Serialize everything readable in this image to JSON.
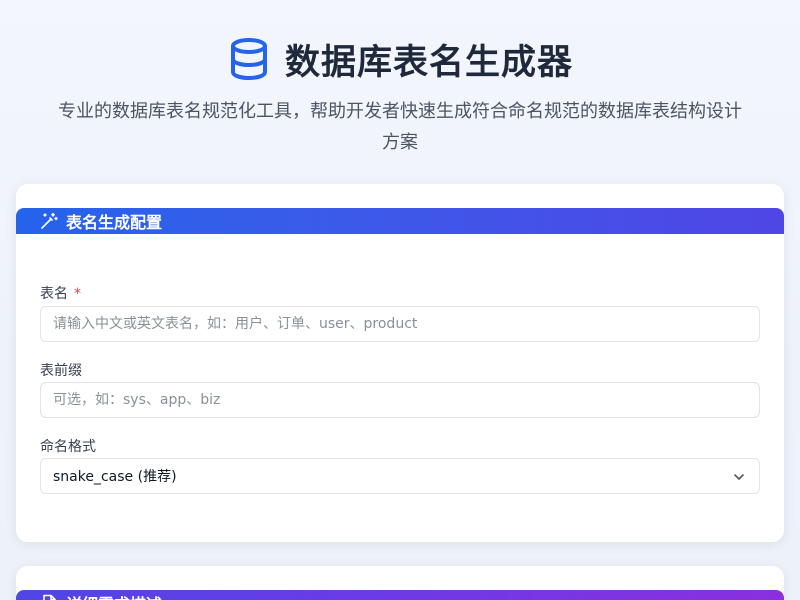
{
  "header": {
    "title": "数据库表名生成器",
    "subtitle": "专业的数据库表名规范化工具，帮助开发者快速生成符合命名规范的数据库表结构设计方案",
    "icon": "database-icon"
  },
  "config_card": {
    "title": "表名生成配置",
    "icon": "magic-wand-icon",
    "table_name": {
      "label": "表名",
      "required_mark": "*",
      "value": "",
      "placeholder": "请输入中文或英文表名，如：用户、订单、user、product"
    },
    "prefix": {
      "label": "表前缀",
      "value": "",
      "placeholder": "可选，如：sys、app、biz"
    },
    "naming_format": {
      "label": "命名格式",
      "selected": "snake_case (推荐)",
      "icon": "chevron-down-icon"
    }
  },
  "requirements_card": {
    "title": "详细需求描述",
    "icon": "document-icon"
  },
  "colors": {
    "accent_blue": "#2563eb",
    "accent_indigo": "#4f46e5",
    "accent_purple": "#8b2fe0",
    "required_red": "#e53e3e"
  }
}
